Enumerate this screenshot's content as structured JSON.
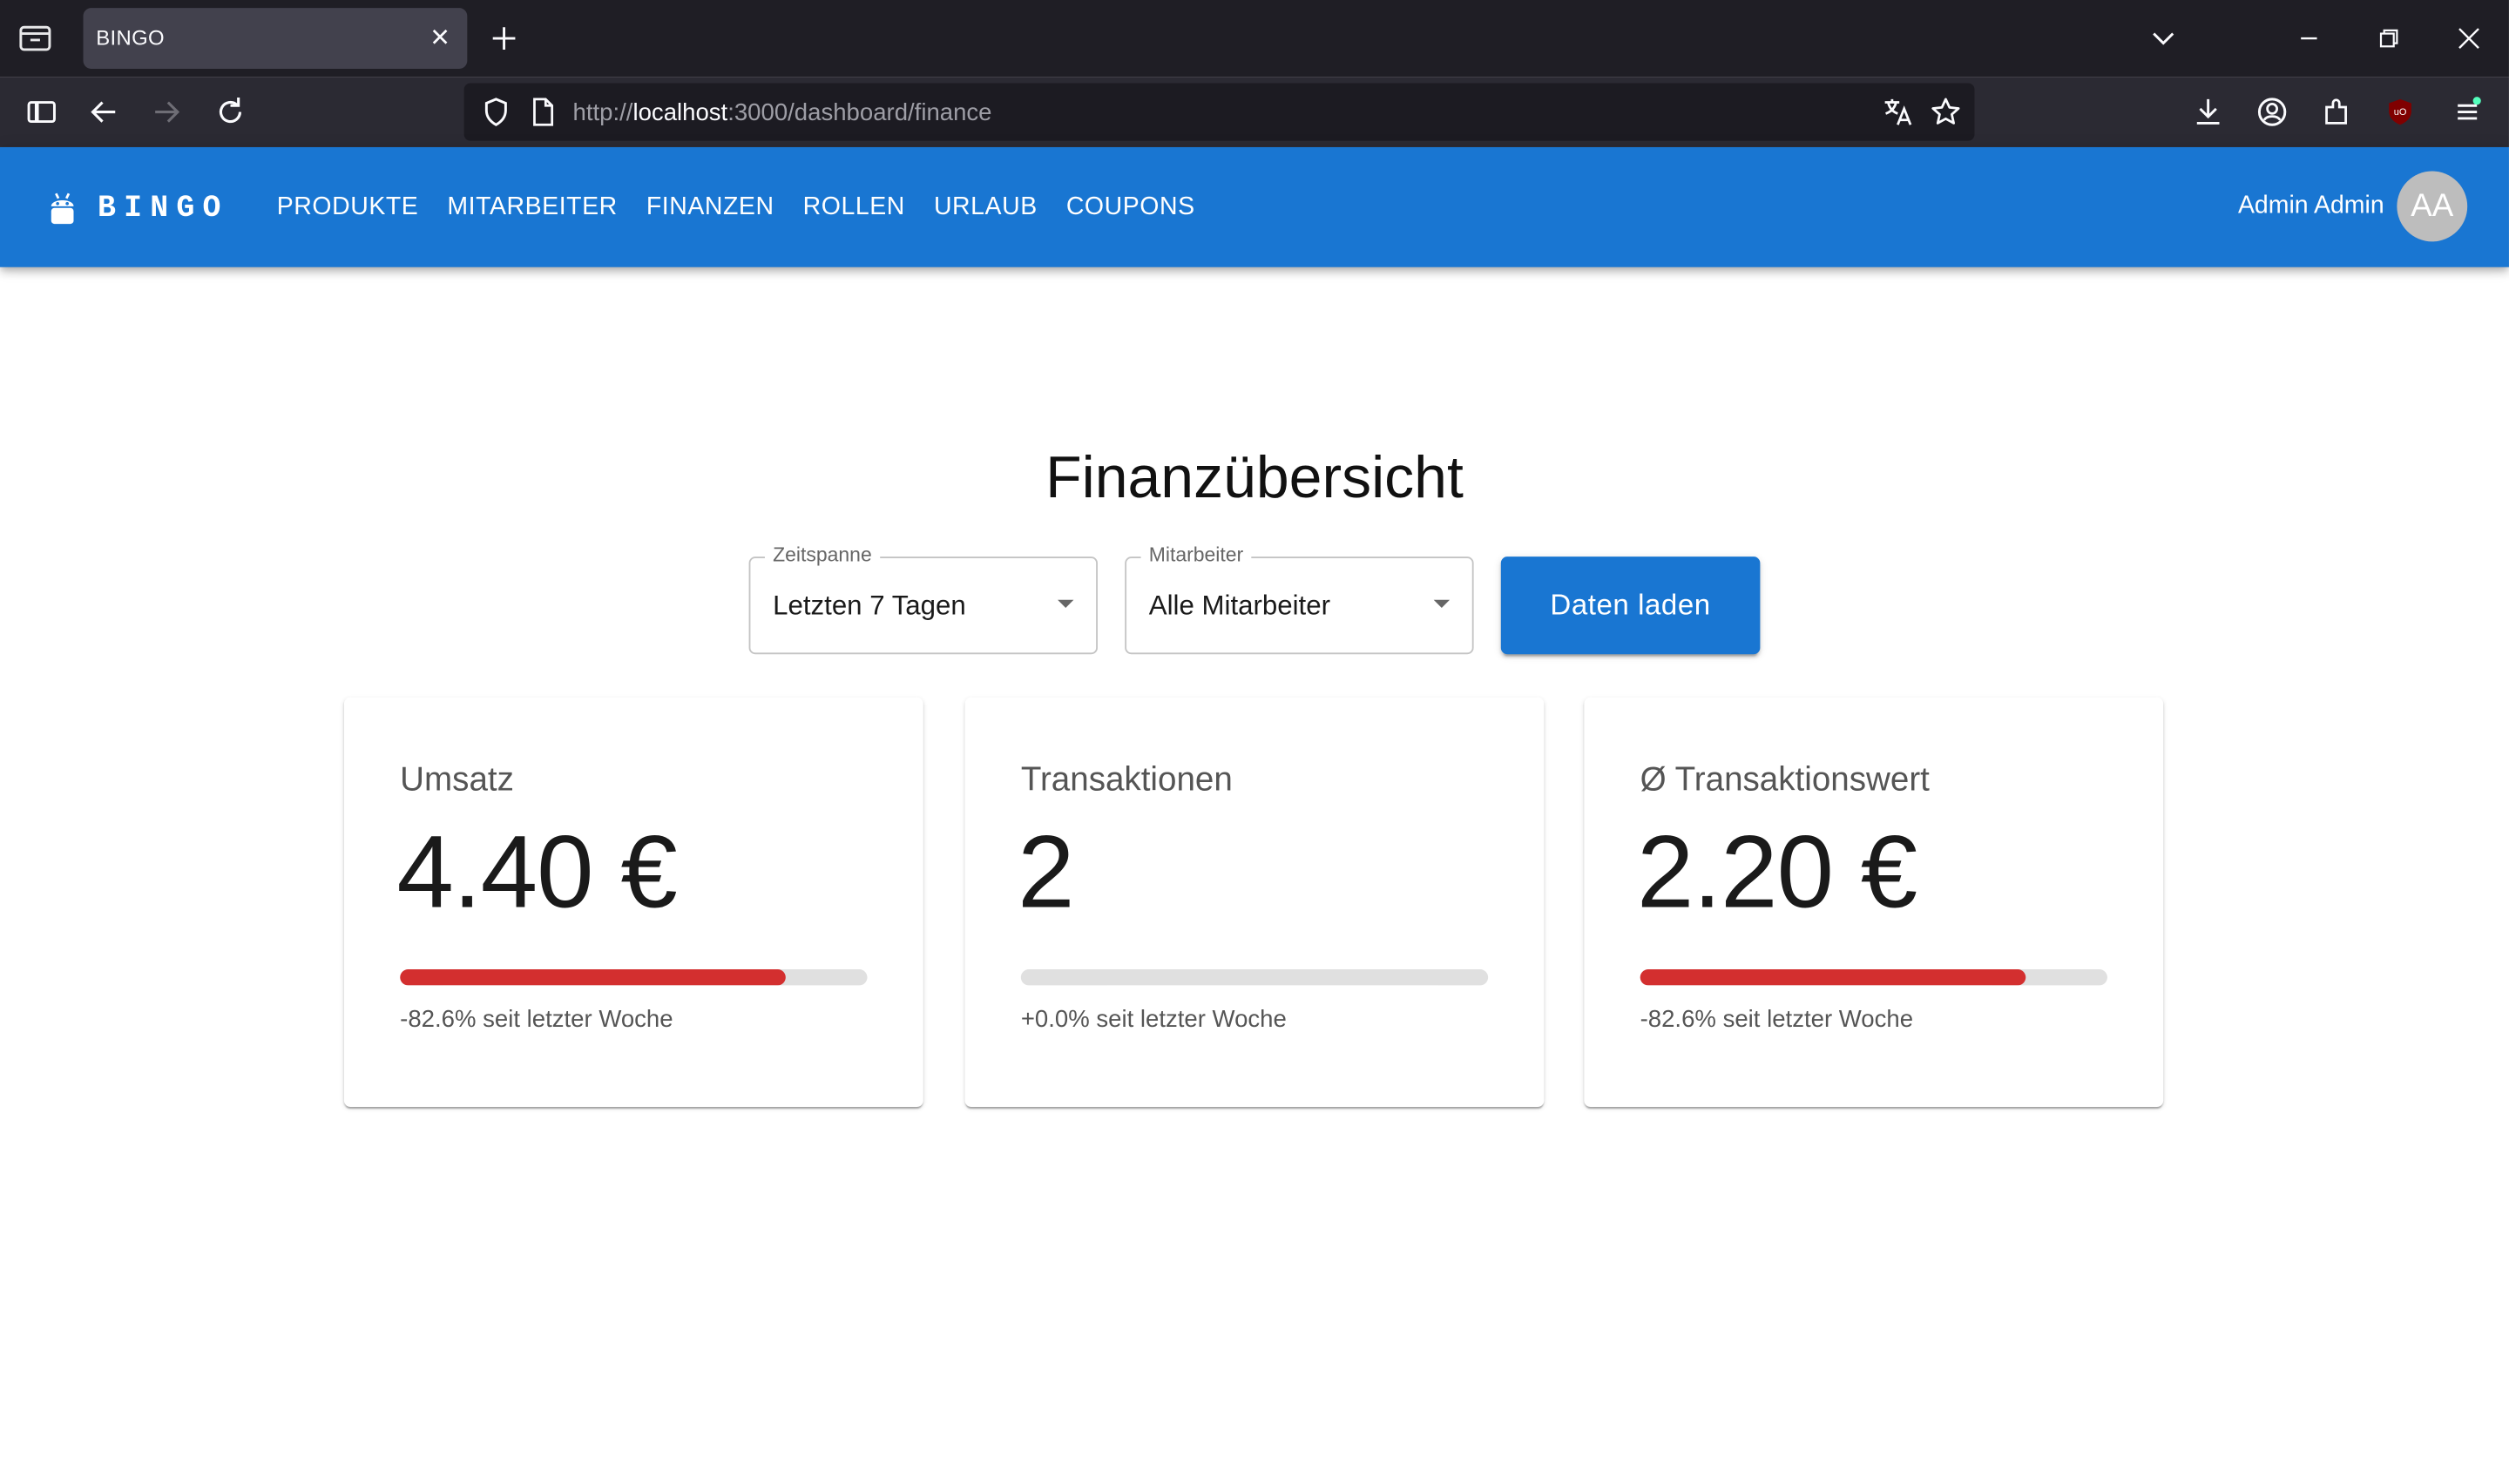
{
  "browser": {
    "tab_title": "BINGO",
    "url_scheme": "http://",
    "url_host": "localhost",
    "url_path": ":3000/dashboard/finance"
  },
  "appbar": {
    "logo": "BINGO",
    "menu": [
      "PRODUKTE",
      "MITARBEITER",
      "FINANZEN",
      "ROLLEN",
      "URLAUB",
      "COUPONS"
    ],
    "user_name": "Admin Admin",
    "avatar_initials": "AA",
    "accent_color": "#1976d2"
  },
  "main": {
    "title": "Finanzübersicht",
    "filters": {
      "zeitspanne": {
        "label": "Zeitspanne",
        "value": "Letzten 7 Tagen"
      },
      "mitarbeiter": {
        "label": "Mitarbeiter",
        "value": "Alle Mitarbeiter"
      }
    },
    "load_button": "Daten laden",
    "cards": [
      {
        "title": "Umsatz",
        "value": "4.40 €",
        "progress": 0.826,
        "note": "-82.6% seit letzter Woche"
      },
      {
        "title": "Transaktionen",
        "value": "2",
        "progress": 0,
        "note": "+0.0% seit letzter Woche"
      },
      {
        "title": "Ø Transaktionswert",
        "value": "2.20 €",
        "progress": 0.826,
        "note": "-82.6% seit letzter Woche"
      }
    ],
    "negative_color": "#d32f2f"
  }
}
